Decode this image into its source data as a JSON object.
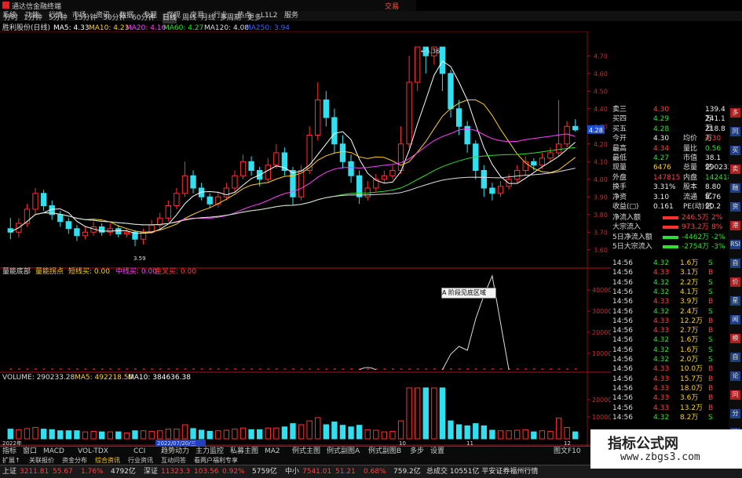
{
  "window": {
    "title": "通达信金融终端",
    "trade_label": "交易",
    "controls": "— □ ×"
  },
  "menu": [
    "系统",
    "功能",
    "行情",
    "市场",
    "资讯",
    "数据",
    "专题",
    "发现",
    "交易",
    "行业",
    "热点",
    "L1L2",
    "服务"
  ],
  "periods": [
    "分时",
    "1分钟",
    "5分钟",
    "15分钟",
    "30分钟",
    "60分钟",
    "日线",
    "周线",
    "月线",
    "多周期",
    "更多"
  ],
  "stock_line": {
    "name": "胜利股份(日线)",
    "ma": [
      {
        "label": "MA5: 4.33",
        "color": "#ffffff"
      },
      {
        "label": "MA10: 4.23",
        "color": "#ffd020"
      },
      {
        "label": "MA20: 4.16",
        "color": "#ff40ff"
      },
      {
        "label": "MA60: 4.27",
        "color": "#30e030"
      },
      {
        "label": "MA120: 4.08",
        "color": "#dddddd"
      },
      {
        "label": "MA250: 3.94",
        "color": "#4060ff"
      }
    ]
  },
  "price_axis": [
    "4.70",
    "4.60",
    "4.50",
    "4.40",
    "4.30",
    "4.20",
    "4.10",
    "4.00",
    "3.90",
    "3.80",
    "3.70",
    "3.60"
  ],
  "price_current": "4.28",
  "price_high_note": "5.36",
  "price_low_note": "3.59",
  "indicator_line": {
    "name": "量能底部",
    "items": [
      {
        "label": "量能拐点",
        "color": "#ffd020"
      },
      {
        "label": "短线买: 0.00",
        "color": "#ffd020"
      },
      {
        "label": "中线买: 0.00",
        "color": "#ff40ff"
      },
      {
        "label": "金叉买: 0.00",
        "color": "#ff4040"
      }
    ],
    "axis": [
      "40000",
      "30000",
      "20000",
      "10000"
    ]
  },
  "volume_line": {
    "items": [
      {
        "label": "VOLUME: 290233.28",
        "color": "#dddddd"
      },
      {
        "label": "MA5: 492218.50",
        "color": "#ffd020"
      },
      {
        "label": "MA10: 384636.38",
        "color": "#ffffff"
      }
    ],
    "axis": [
      "20000",
      "10000"
    ]
  },
  "x_labels": [
    "2022年",
    "2022/07/20/三",
    "10",
    "11",
    "12"
  ],
  "tooltip": "A 阶段见底区域",
  "quote": [
    {
      "k": "卖三",
      "v": "4.30",
      "k2": "",
      "v2": "139.4万",
      "vc": "red",
      "v2c": "white"
    },
    {
      "k": "买四",
      "v": "4.29",
      "k2": "",
      "v2": "241.1万",
      "vc": "green",
      "v2c": "white"
    },
    {
      "k": "买五",
      "v": "4.28",
      "k2": "",
      "v2": "218.8万",
      "vc": "green",
      "v2c": "white"
    },
    {
      "k": "今开",
      "v": "4.30",
      "k2": "均价",
      "v2": "4.30",
      "vc": "white",
      "v2c": "red"
    },
    {
      "k": "最高",
      "v": "4.34",
      "k2": "量比",
      "v2": "0.56",
      "vc": "red",
      "v2c": "green"
    },
    {
      "k": "最低",
      "v": "4.27",
      "k2": "市值",
      "v2": "38.1亿",
      "vc": "green",
      "v2c": "white"
    },
    {
      "k": "现量",
      "v": "6476",
      "k2": "总量",
      "v2": "290233",
      "vc": "yellow",
      "v2c": "white"
    },
    {
      "k": "外盘",
      "v": "147815",
      "k2": "内盘",
      "v2": "142418",
      "vc": "red",
      "v2c": "green"
    },
    {
      "k": "换手",
      "v": "3.31%",
      "k2": "股本",
      "v2": "8.80亿",
      "vc": "white",
      "v2c": "white"
    },
    {
      "k": "净资",
      "v": "3.10",
      "k2": "流通",
      "v2": "8.76亿",
      "vc": "white",
      "v2c": "white"
    },
    {
      "k": "收益(□)",
      "v": "0.161",
      "k2": "PE(动)",
      "v2": "20.2",
      "vc": "white",
      "v2c": "white"
    }
  ],
  "flows": [
    {
      "k": "净流入额",
      "v": "246.5万",
      "p": "2%",
      "c": "red"
    },
    {
      "k": "大宗流入",
      "v": "973.2万",
      "p": "8%",
      "c": "red"
    },
    {
      "k": "5日净流入额",
      "v": "-4462万",
      "p": "-2%",
      "c": "green"
    },
    {
      "k": "5日大宗流入",
      "v": "-2754万",
      "p": "-3%",
      "c": "green"
    }
  ],
  "ticks": [
    {
      "t": "14:56",
      "p": "4.32",
      "v": "1.6万",
      "s": "S",
      "pc": "green",
      "vc": "yellow",
      "sc": "green"
    },
    {
      "t": "14:56",
      "p": "4.33",
      "v": "3.1万",
      "s": "B",
      "pc": "red",
      "vc": "yellow",
      "sc": "red"
    },
    {
      "t": "14:56",
      "p": "4.32",
      "v": "2.2万",
      "s": "S",
      "pc": "green",
      "vc": "yellow",
      "sc": "green"
    },
    {
      "t": "14:56",
      "p": "4.32",
      "v": "4.1万",
      "s": "S",
      "pc": "green",
      "vc": "yellow",
      "sc": "green"
    },
    {
      "t": "14:56",
      "p": "4.33",
      "v": "3.9万",
      "s": "B",
      "pc": "red",
      "vc": "yellow",
      "sc": "red"
    },
    {
      "t": "14:56",
      "p": "4.32",
      "v": "2.4万",
      "s": "S",
      "pc": "green",
      "vc": "yellow",
      "sc": "green"
    },
    {
      "t": "14:56",
      "p": "4.33",
      "v": "12.2万",
      "s": "B",
      "pc": "red",
      "vc": "yellow",
      "sc": "red"
    },
    {
      "t": "14:56",
      "p": "4.33",
      "v": "2.7万",
      "s": "B",
      "pc": "red",
      "vc": "yellow",
      "sc": "red"
    },
    {
      "t": "14:56",
      "p": "4.32",
      "v": "1.6万",
      "s": "S",
      "pc": "green",
      "vc": "yellow",
      "sc": "green"
    },
    {
      "t": "14:56",
      "p": "4.32",
      "v": "1.6万",
      "s": "S",
      "pc": "green",
      "vc": "yellow",
      "sc": "green"
    },
    {
      "t": "14:56",
      "p": "4.32",
      "v": "2.0万",
      "s": "S",
      "pc": "green",
      "vc": "yellow",
      "sc": "green"
    },
    {
      "t": "14:56",
      "p": "4.33",
      "v": "10.0万",
      "s": "B",
      "pc": "red",
      "vc": "yellow",
      "sc": "red"
    },
    {
      "t": "14:56",
      "p": "4.33",
      "v": "15.7万",
      "s": "B",
      "pc": "red",
      "vc": "yellow",
      "sc": "red"
    },
    {
      "t": "14:56",
      "p": "4.33",
      "v": "18.0万",
      "s": "B",
      "pc": "red",
      "vc": "yellow",
      "sc": "red"
    },
    {
      "t": "14:56",
      "p": "4.33",
      "v": "3.6万",
      "s": "B",
      "pc": "red",
      "vc": "yellow",
      "sc": "red"
    },
    {
      "t": "14:56",
      "p": "4.33",
      "v": "13.2万",
      "s": "B",
      "pc": "red",
      "vc": "yellow",
      "sc": "red"
    },
    {
      "t": "14:56",
      "p": "4.32",
      "v": "8.2万",
      "s": "S",
      "pc": "green",
      "vc": "yellow",
      "sc": "green"
    }
  ],
  "bottom_tabs": [
    "指标",
    "窗口",
    "MACD",
    "VOL-TDX",
    "CCI",
    "趋势动力",
    "主力监控",
    "私募主图",
    "MA2",
    "例式主图",
    "例式副图A",
    "例式副图B",
    "多步",
    "设置"
  ],
  "bottom_tabs2": [
    "扩展↑",
    "关联报价",
    "资金分布",
    "综合资讯",
    "行业资讯",
    "互动问答",
    "看两户福利专享"
  ],
  "bottom_right": "图文F10",
  "status": [
    {
      "label": "上证",
      "value": "3211.81",
      "chg": "55.67",
      "pct": "1.76%",
      "amt": "4792亿"
    },
    {
      "label": "深证",
      "value": "11323.3",
      "chg": "103.56",
      "pct": "0.92%",
      "amt": "5759亿"
    },
    {
      "label": "中小",
      "value": "7541.01",
      "chg": "51.21",
      "pct": "0.68%",
      "amt": "759.2亿"
    }
  ],
  "status_tail": "总成交 10551亿 平安证券福州行情",
  "watermark": {
    "title": "指标公式网",
    "url": "www.zbgs3.com"
  },
  "right_icons": [
    "多",
    "同",
    "买",
    "卖",
    "融",
    "资",
    "港",
    "RSI",
    "自",
    "价",
    "星",
    "闻",
    "模",
    "自",
    "论",
    "同",
    "分",
    "笔"
  ],
  "chart_data": {
    "type": "candlestick",
    "title": "胜利股份(日线)",
    "ylim": [
      3.55,
      4.75
    ],
    "high_label": 5.36,
    "low_label": 3.59,
    "last": 4.28,
    "candles": [
      [
        3.72,
        3.7,
        3.78,
        3.66
      ],
      [
        3.7,
        3.75,
        3.78,
        3.67
      ],
      [
        3.75,
        3.83,
        3.86,
        3.73
      ],
      [
        3.83,
        3.92,
        3.95,
        3.8
      ],
      [
        3.92,
        3.85,
        3.94,
        3.82
      ],
      [
        3.85,
        3.8,
        3.88,
        3.77
      ],
      [
        3.8,
        3.76,
        3.82,
        3.73
      ],
      [
        3.76,
        3.72,
        3.78,
        3.69
      ],
      [
        3.72,
        3.68,
        3.74,
        3.65
      ],
      [
        3.68,
        3.7,
        3.73,
        3.66
      ],
      [
        3.7,
        3.73,
        3.76,
        3.68
      ],
      [
        3.73,
        3.7,
        3.75,
        3.68
      ],
      [
        3.7,
        3.72,
        3.75,
        3.68
      ],
      [
        3.72,
        3.69,
        3.74,
        3.67
      ],
      [
        3.69,
        3.7,
        3.72,
        3.67
      ],
      [
        3.7,
        3.66,
        3.71,
        3.62
      ],
      [
        3.66,
        3.7,
        3.72,
        3.63
      ],
      [
        3.7,
        3.74,
        3.77,
        3.69
      ],
      [
        3.74,
        3.78,
        3.81,
        3.72
      ],
      [
        3.78,
        3.85,
        3.88,
        3.76
      ],
      [
        3.85,
        3.92,
        3.95,
        3.83
      ],
      [
        3.92,
        4.02,
        4.1,
        3.9
      ],
      [
        4.02,
        3.95,
        4.05,
        3.92
      ],
      [
        3.95,
        3.9,
        3.98,
        3.88
      ],
      [
        3.9,
        3.86,
        3.92,
        3.84
      ],
      [
        3.86,
        3.9,
        3.93,
        3.84
      ],
      [
        3.9,
        3.95,
        3.98,
        3.88
      ],
      [
        3.95,
        4.02,
        4.05,
        3.93
      ],
      [
        4.02,
        4.1,
        4.14,
        4.0
      ],
      [
        4.1,
        4.05,
        4.13,
        4.02
      ],
      [
        4.05,
        4.0,
        4.07,
        3.96
      ],
      [
        4.0,
        4.08,
        4.12,
        3.98
      ],
      [
        4.08,
        4.15,
        4.2,
        4.06
      ],
      [
        4.15,
        4.05,
        4.18,
        4.02
      ],
      [
        4.05,
        3.9,
        4.07,
        3.85
      ],
      [
        3.9,
        4.05,
        4.08,
        3.88
      ],
      [
        4.05,
        4.25,
        4.3,
        4.03
      ],
      [
        4.25,
        4.45,
        4.55,
        4.22
      ],
      [
        4.45,
        4.35,
        4.5,
        4.3
      ],
      [
        4.35,
        4.2,
        4.4,
        4.15
      ],
      [
        4.2,
        4.1,
        4.25,
        4.06
      ],
      [
        4.1,
        4.02,
        4.14,
        3.98
      ],
      [
        4.02,
        3.9,
        4.05,
        3.86
      ],
      [
        3.9,
        3.95,
        3.99,
        3.88
      ],
      [
        3.95,
        4.0,
        4.03,
        3.93
      ],
      [
        4.0,
        4.02,
        4.05,
        3.98
      ],
      [
        4.02,
        4.05,
        4.08,
        4.0
      ],
      [
        4.05,
        4.2,
        4.3,
        4.03
      ],
      [
        4.2,
        4.55,
        4.7,
        4.18
      ],
      [
        4.55,
        4.75,
        4.75,
        4.5
      ],
      [
        4.75,
        4.7,
        4.75,
        4.6
      ],
      [
        4.7,
        4.75,
        4.75,
        4.65
      ],
      [
        4.75,
        4.6,
        4.75,
        4.5
      ],
      [
        4.6,
        4.4,
        4.62,
        4.35
      ],
      [
        4.4,
        4.3,
        4.45,
        4.25
      ],
      [
        4.3,
        4.2,
        4.33,
        4.15
      ],
      [
        4.2,
        4.05,
        4.22,
        4.0
      ],
      [
        4.05,
        3.95,
        4.08,
        3.9
      ],
      [
        3.95,
        3.92,
        3.98,
        3.88
      ],
      [
        3.92,
        3.96,
        3.99,
        3.9
      ],
      [
        3.96,
        4.0,
        4.03,
        3.94
      ],
      [
        4.0,
        4.05,
        4.08,
        3.98
      ],
      [
        4.05,
        4.1,
        4.13,
        4.02
      ],
      [
        4.1,
        4.08,
        4.12,
        4.05
      ],
      [
        4.08,
        4.12,
        4.15,
        4.06
      ],
      [
        4.12,
        4.15,
        4.18,
        4.1
      ],
      [
        4.15,
        4.2,
        4.45,
        4.13
      ],
      [
        4.2,
        4.3,
        4.33,
        4.18
      ],
      [
        4.3,
        4.28,
        4.34,
        4.27
      ]
    ]
  }
}
